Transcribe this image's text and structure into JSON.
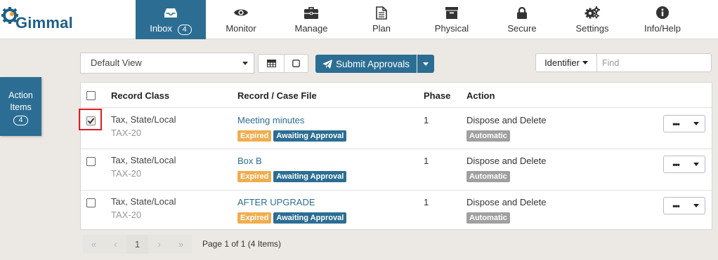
{
  "app": {
    "logo_text": "Gimmal"
  },
  "nav": {
    "items": [
      {
        "label": "Inbox",
        "badge": "4"
      },
      {
        "label": "Monitor"
      },
      {
        "label": "Manage"
      },
      {
        "label": "Plan"
      },
      {
        "label": "Physical"
      },
      {
        "label": "Secure"
      },
      {
        "label": "Settings"
      },
      {
        "label": "Info/Help"
      }
    ]
  },
  "side_tab": {
    "line1": "Action",
    "line2": "Items",
    "badge": "4"
  },
  "toolbar": {
    "view_select": "Default View",
    "submit_label": "Submit Approvals",
    "identifier_label": "Identifier",
    "find_placeholder": "Find"
  },
  "table": {
    "headers": {
      "record_class": "Record Class",
      "record_case_file": "Record / Case File",
      "phase": "Phase",
      "action": "Action"
    },
    "rows": [
      {
        "checked": true,
        "record_class": "Tax, State/Local",
        "record_code": "TAX-20",
        "record_name": "Meeting minutes",
        "status_1": "Expired",
        "status_2": "Awaiting Approval",
        "phase": "1",
        "action": "Dispose and Delete",
        "action_mode": "Automatic"
      },
      {
        "checked": false,
        "record_class": "Tax, State/Local",
        "record_code": "TAX-20",
        "record_name": "Box B",
        "status_1": "Expired",
        "status_2": "Awaiting Approval",
        "phase": "1",
        "action": "Dispose and Delete",
        "action_mode": "Automatic"
      },
      {
        "checked": false,
        "record_class": "Tax, State/Local",
        "record_code": "TAX-20",
        "record_name": "AFTER UPGRADE",
        "status_1": "Expired",
        "status_2": "Awaiting Approval",
        "phase": "1",
        "action": "Dispose and Delete",
        "action_mode": "Automatic"
      }
    ],
    "more_label": "•••"
  },
  "pager": {
    "first": "«",
    "prev": "‹",
    "current": "1",
    "next": "›",
    "last": "»",
    "info": "Page 1 of 1 (4 Items)"
  },
  "colors": {
    "accent": "#2c6e93",
    "expired": "#f0ad4e",
    "automatic": "#a0a0a0",
    "highlight": "#e01b24",
    "page_bg": "#ece9e4"
  }
}
